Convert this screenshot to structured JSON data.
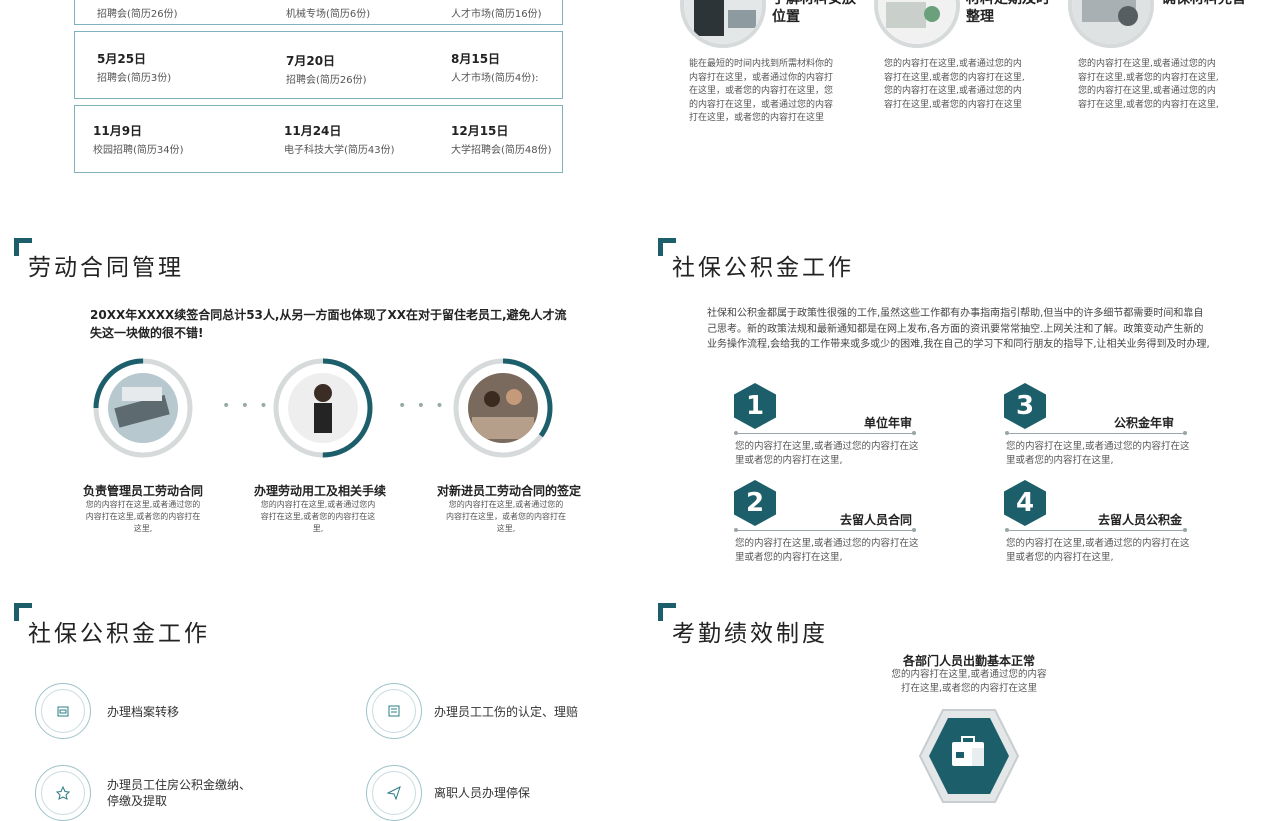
{
  "recruitment": {
    "rows": [
      [
        {
          "date": "",
          "desc": "招聘会(简历26份)"
        },
        {
          "date": "",
          "desc": "机械专场(简历6份)"
        },
        {
          "date": "",
          "desc": "人才市场(简历16份)"
        }
      ],
      [
        {
          "date": "5月25日",
          "desc": "招聘会(简历3份)"
        },
        {
          "date": "7月20日",
          "desc": "招聘会(简历26份)"
        },
        {
          "date": "8月15日",
          "desc": "人才市场(简历4份):"
        }
      ],
      [
        {
          "date": "11月9日",
          "desc": "校园招聘(简历34份)"
        },
        {
          "date": "11月24日",
          "desc": "电子科技大学(简历43份)"
        },
        {
          "date": "12月15日",
          "desc": "大学招聘会(简历48份)"
        }
      ]
    ]
  },
  "materials": {
    "items": [
      {
        "title_l1": "了解材料安放",
        "title_l2": "位置",
        "desc": "能在最短的时间内找到所需材料你的内容打在这里，或者通过你的内容打在这里，或者您的内容打在这里，您的内容打在这里，或者通过您的内容打在这里，或者您的内容打在这里"
      },
      {
        "title_l1": "材料定期及时",
        "title_l2": "整理",
        "desc": "您的内容打在这里,或者通过您的内容打在这里,或者您的内容打在这里,您的内容打在这里,或者通过您的内容打在这里,或者您的内容打在这里"
      },
      {
        "title_l1": "确保材料完善",
        "title_l2": "",
        "desc": "您的内容打在这里,或者通过您的内容打在这里,或者您的内容打在这里,您的内容打在这里,或者通过您的内容打在这里,或者您的内容打在这里,"
      }
    ]
  },
  "labor": {
    "title": "劳动合同管理",
    "intro": "20XX年XXXX续签合同总计53人,从另一方面也体现了XX在对于留住老员工,避免人才流失这一块做的很不错!",
    "items": [
      {
        "title": "负责管理员工劳动合同",
        "desc": "您的内容打在这里,或者通过您的内容打在这里,或者您的内容打在这里,",
        "progress": 0.25
      },
      {
        "title": "办理劳动用工及相关手续",
        "desc": "您的内容打在这里,或者通过您内容打在这里,或者您的内容打在这里,",
        "progress": 0.5
      },
      {
        "title": "对新进员工劳动合同的签定",
        "desc": "您的内容打在这里,或者通过您的内容打在这里，或者您的内容打在这里,",
        "progress": 0.35
      }
    ]
  },
  "social": {
    "title": "社保公积金工作",
    "intro": "社保和公积金都属于政策性很强的工作,虽然这些工作都有办事指南指引帮助,但当中的许多细节都需要时间和靠自己思考。新的政策法规和最新通知都是在网上发布,各方面的资讯要常常抽空.上网关注和了解。政策变动产生新的业务操作流程,会给我的工作带来或多或少的困难,我在自己的学习下和同行朋友的指导下,让相关业务得到及时办理,",
    "items": [
      {
        "num": "1",
        "label": "单位年审",
        "desc": "您的内容打在这里,或者通过您的内容打在这里或者您的内容打在这里,"
      },
      {
        "num": "3",
        "label": "公积金年审",
        "desc": "您的内容打在这里,或者通过您的内容打在这里或者您的内容打在这里,"
      },
      {
        "num": "2",
        "label": "去留人员合同",
        "desc": "您的内容打在这里,或者通过您的内容打在这里或者您的内容打在这里,"
      },
      {
        "num": "4",
        "label": "去留人员公积金",
        "desc": "您的内容打在这里,或者通过您的内容打在这里或者您的内容打在这里,"
      }
    ]
  },
  "social2": {
    "title": "社保公积金工作",
    "items": [
      {
        "icon": "archive-icon",
        "text": "办理档案转移"
      },
      {
        "icon": "document-icon",
        "text": "办理员工工伤的认定、理赔"
      },
      {
        "icon": "star-icon",
        "text_l1": "办理员工住房公积金缴纳、",
        "text_l2": "停缴及提取"
      },
      {
        "icon": "send-icon",
        "text": "离职人员办理停保"
      }
    ]
  },
  "attendance": {
    "title": "考勤绩效制度",
    "item_title": "各部门人员出勤基本正常",
    "item_desc": "您的内容打在这里,或者通过您的内容打在这里,或者您的内容打在这里"
  },
  "colors": {
    "accent": "#1c5f6b",
    "ring": "#d6dadb"
  }
}
